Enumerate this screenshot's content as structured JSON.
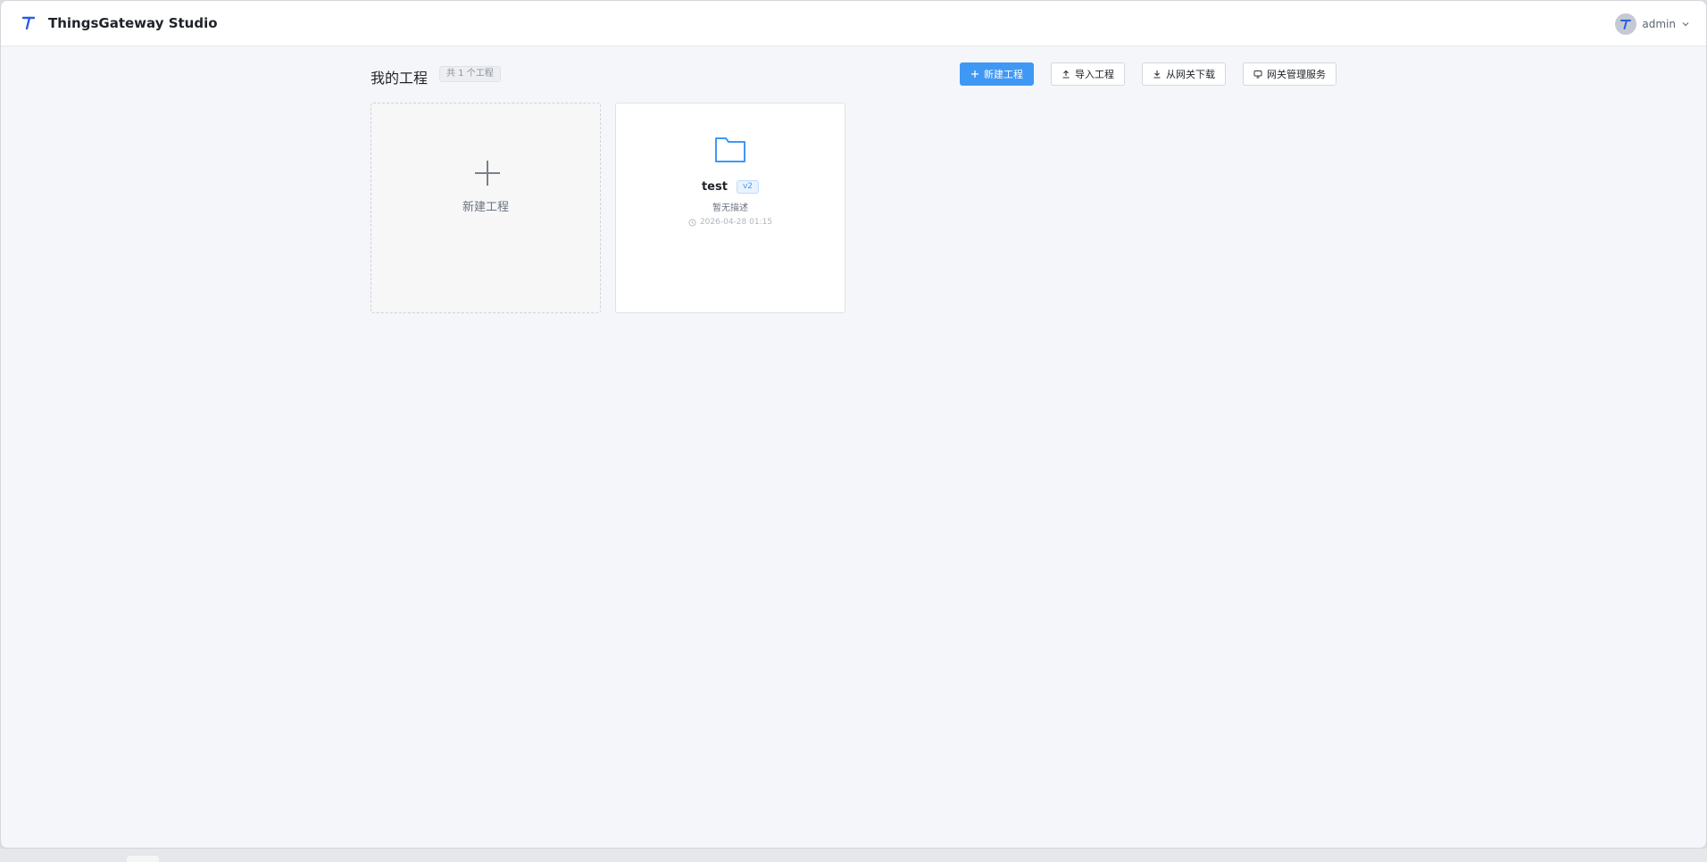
{
  "header": {
    "app_title": "ThingsGateway Studio",
    "logo_letter": "T",
    "user": {
      "name": "admin"
    }
  },
  "page": {
    "title": "我的工程",
    "count_badge": "共 1 个工程"
  },
  "toolbar": {
    "new_project": "新建工程",
    "import_project": "导入工程",
    "download_from_gateway": "从网关下载",
    "gateway_service": "网关管理服务"
  },
  "cards": {
    "new_label": "新建工程",
    "projects": [
      {
        "name": "test",
        "version": "v2",
        "description": "暂无描述",
        "updated": "2026-04-28 01:15"
      }
    ]
  },
  "colors": {
    "accent": "#3f98f4",
    "background": "#f4f6f9",
    "header_bg": "#ffffff"
  },
  "icons": [
    "logo-icon",
    "chevron-down-icon",
    "plus-icon",
    "upload-icon",
    "download-icon",
    "monitor-icon",
    "folder-icon",
    "clock-icon"
  ]
}
